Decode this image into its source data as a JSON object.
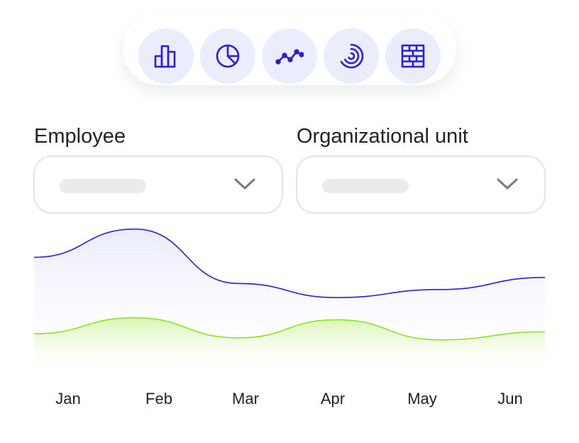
{
  "toolbar": {
    "buttons": [
      {
        "icon": "bar-chart-icon"
      },
      {
        "icon": "pie-chart-icon"
      },
      {
        "icon": "line-chart-icon"
      },
      {
        "icon": "radial-chart-icon"
      },
      {
        "icon": "heatmap-grid-icon"
      }
    ],
    "icon_color": "#2a1fd6",
    "button_bg": "#e9edfc"
  },
  "filters": {
    "employee": {
      "label": "Employee",
      "value": ""
    },
    "org_unit": {
      "label": "Organizational unit",
      "value": ""
    }
  },
  "chart_data": {
    "type": "area",
    "categories": [
      "Jan",
      "Feb",
      "Mar",
      "Apr",
      "May",
      "Jun"
    ],
    "series": [
      {
        "color": "#2a1fd6",
        "values": [
          58,
          72,
          45,
          38,
          42,
          48
        ]
      },
      {
        "color": "#8fe02a",
        "values": [
          20,
          28,
          18,
          27,
          17,
          21
        ]
      }
    ],
    "ylim": [
      0,
      80
    ],
    "grid": false,
    "legend": "none"
  }
}
